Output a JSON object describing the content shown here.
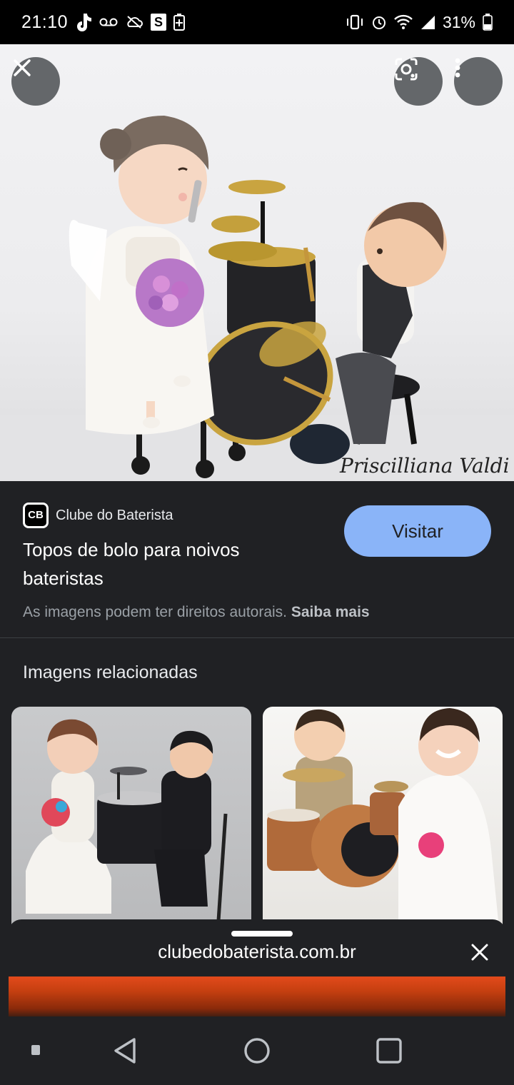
{
  "status_bar": {
    "time": "21:10",
    "battery": "31%",
    "s_badge": "S"
  },
  "hero": {
    "watermark": "Priscilliana Valdi"
  },
  "source": {
    "logo_text": "CB",
    "name": "Clube do Baterista"
  },
  "result": {
    "title": "Topos de bolo para noivos bateristas",
    "visit_label": "Visitar",
    "copyright_text": "As imagens podem ter direitos autorais.",
    "learn_more": "Saiba mais"
  },
  "related": {
    "heading": "Imagens relacionadas"
  },
  "sheet": {
    "url": "clubedobaterista.com.br"
  },
  "colors": {
    "accent": "#8ab4f8",
    "background": "#202124",
    "site_brand": "#e34a1b"
  }
}
